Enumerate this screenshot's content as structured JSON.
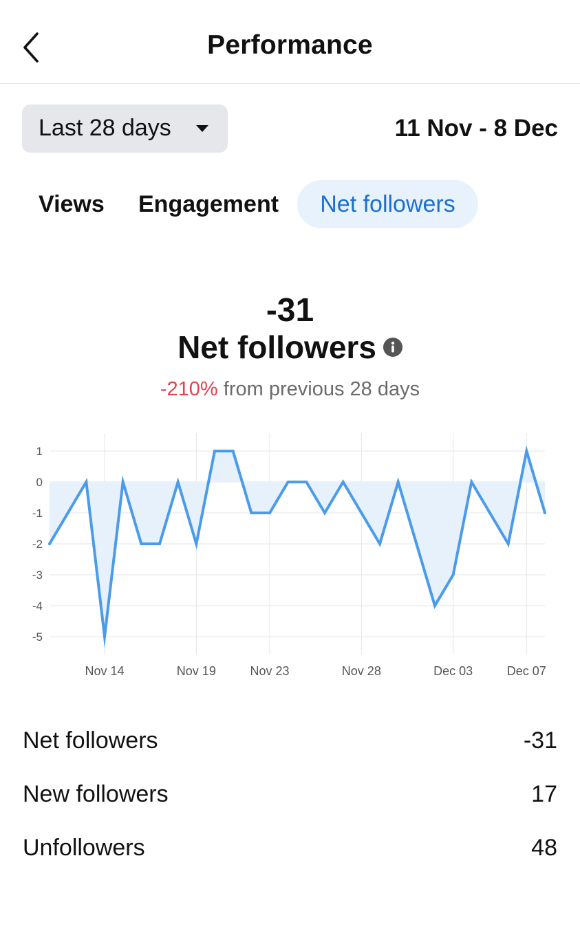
{
  "header": {
    "title": "Performance",
    "back_icon": "chevron-left-icon"
  },
  "filter": {
    "range_label": "Last 28 days",
    "date_range": "11 Nov - 8 Dec"
  },
  "tabs": [
    {
      "label": "Views",
      "active": false
    },
    {
      "label": "Engagement",
      "active": false
    },
    {
      "label": "Net followers",
      "active": true
    }
  ],
  "headline": {
    "value": "-31",
    "label": "Net followers",
    "change_pct": "-210%",
    "change_text": "from previous 28 days"
  },
  "colors": {
    "accent": "#1a6fd1",
    "line": "#4a9bea",
    "fill": "#e6f1fc",
    "negative": "#e0444f",
    "active_tab_bg": "#e8f2fd",
    "range_button_bg": "#e5e7eb"
  },
  "chart_data": {
    "type": "line",
    "x": [
      "Nov 11",
      "Nov 12",
      "Nov 13",
      "Nov 14",
      "Nov 15",
      "Nov 16",
      "Nov 17",
      "Nov 18",
      "Nov 19",
      "Nov 20",
      "Nov 21",
      "Nov 22",
      "Nov 23",
      "Nov 24",
      "Nov 25",
      "Nov 26",
      "Nov 27",
      "Nov 28",
      "Nov 29",
      "Nov 30",
      "Dec 01",
      "Dec 02",
      "Dec 03",
      "Dec 04",
      "Dec 05",
      "Dec 06",
      "Dec 07",
      "Dec 08"
    ],
    "values": [
      -2,
      -1,
      0,
      -5,
      0,
      -2,
      -2,
      0,
      -2,
      1,
      1,
      -1,
      -1,
      0,
      0,
      -1,
      0,
      -1,
      -2,
      0,
      -2,
      -4,
      -3,
      0,
      -1,
      -2,
      1,
      -1
    ],
    "x_ticks": [
      "Nov 14",
      "Nov 19",
      "Nov 23",
      "Nov 28",
      "Dec 03",
      "Dec 07"
    ],
    "y_ticks": [
      "1",
      "0",
      "-1",
      "-2",
      "-3",
      "-4",
      "-5"
    ],
    "ylim": [
      -5,
      1
    ],
    "grid": true,
    "title": "",
    "xlabel": "",
    "ylabel": ""
  },
  "summary": [
    {
      "label": "Net followers",
      "value": "-31"
    },
    {
      "label": "New followers",
      "value": "17"
    },
    {
      "label": "Unfollowers",
      "value": "48"
    }
  ]
}
